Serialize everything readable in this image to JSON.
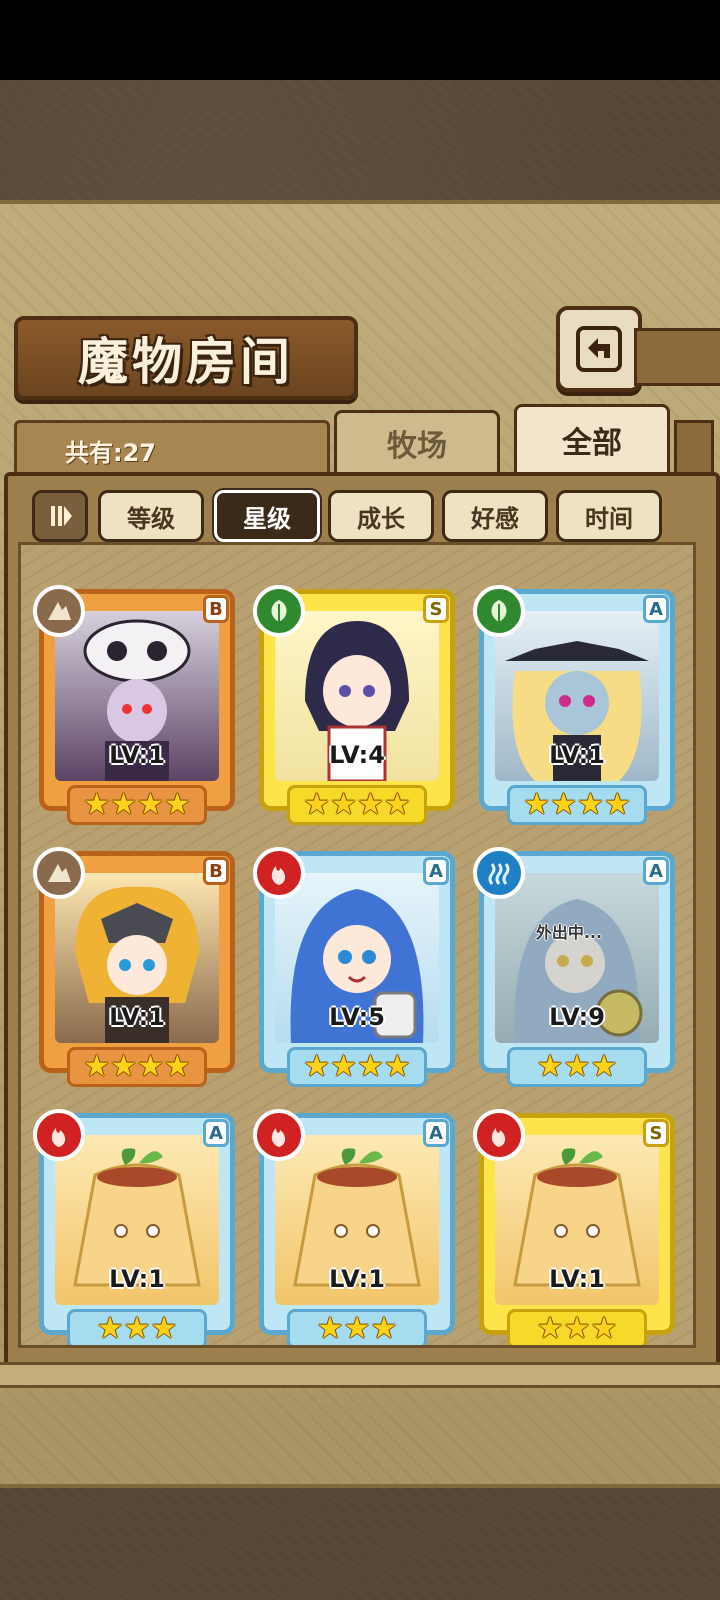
{
  "header": {
    "title": "魔物房间"
  },
  "tabs": {
    "count_label": "共有:27",
    "ranch": "牧场",
    "all": "全部"
  },
  "sort": {
    "toggle_symbol": "⏸",
    "level": "等级",
    "star": "星级",
    "growth": "成长",
    "favor": "好感",
    "time": "时间",
    "active": "星级"
  },
  "monsters": [
    {
      "level": "LV:1",
      "rank": "B",
      "element": "earth",
      "stars": 4,
      "rarity": "orange",
      "status": ""
    },
    {
      "level": "LV:4",
      "rank": "S",
      "element": "leaf",
      "stars": 4,
      "rarity": "yellow",
      "status": ""
    },
    {
      "level": "LV:1",
      "rank": "A",
      "element": "leaf",
      "stars": 4,
      "rarity": "blue",
      "status": ""
    },
    {
      "level": "LV:1",
      "rank": "B",
      "element": "earth",
      "stars": 4,
      "rarity": "orange",
      "status": ""
    },
    {
      "level": "LV:5",
      "rank": "A",
      "element": "fire",
      "stars": 4,
      "rarity": "blue",
      "status": ""
    },
    {
      "level": "LV:9",
      "rank": "A",
      "element": "water",
      "stars": 3,
      "rarity": "blue",
      "status": "外出中..."
    },
    {
      "level": "LV:1",
      "rank": "A",
      "element": "fire",
      "stars": 3,
      "rarity": "blue",
      "status": ""
    },
    {
      "level": "LV:1",
      "rank": "A",
      "element": "fire",
      "stars": 3,
      "rarity": "blue",
      "status": ""
    },
    {
      "level": "LV:1",
      "rank": "S",
      "element": "fire",
      "stars": 3,
      "rarity": "yellow",
      "status": ""
    }
  ],
  "colors": {
    "orange_frame": "#f0a040",
    "yellow_frame": "#fde44a",
    "blue_frame": "#bfe6f4",
    "fire": "#d02222",
    "leaf": "#2f8a2f",
    "earth": "#8a6a4c",
    "water": "#1f7fc4"
  }
}
